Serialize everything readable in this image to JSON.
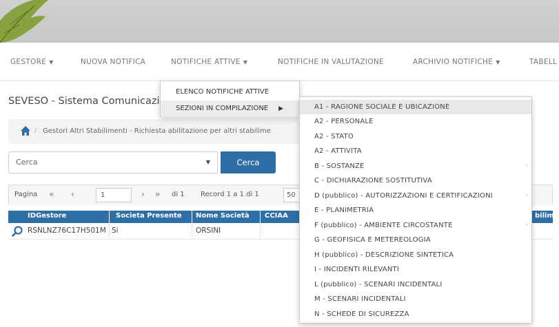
{
  "nav": {
    "items": [
      {
        "label": "GESTORE",
        "caret": true
      },
      {
        "label": "NUOVA NOTIFICA",
        "caret": false
      },
      {
        "label": "NOTIFICHE ATTIVE",
        "caret": true
      },
      {
        "label": "NOTIFICHE IN VALUTAZIONE",
        "caret": false
      },
      {
        "label": "ARCHIVIO NOTIFICHE",
        "caret": true
      },
      {
        "label": "TABELL",
        "caret": false
      }
    ],
    "caret_glyph": "▼"
  },
  "page_title": "SEVESO - Sistema Comunicazi",
  "breadcrumb": {
    "separator": "/",
    "text": "Gestori Altri Stabilimenti - Richiesta abilitazione per altri stabilime"
  },
  "search": {
    "placeholder": "Cerca",
    "button_label": "Cerca",
    "caret": "▼"
  },
  "pager": {
    "label": "Pagina",
    "first": "«",
    "prev": "‹",
    "page": "1",
    "next": "›",
    "last": "»",
    "of": "di 1",
    "records": "Record 1 a 1 di 1",
    "rows_per_page": "50"
  },
  "table": {
    "columns": [
      "IDGestore",
      "Societa Presente",
      "Nome Società",
      "CCIAA",
      "bilimen"
    ],
    "rows": [
      {
        "id": "RSNLNZ76C17H501M",
        "presente": "Si",
        "nome": "ORSINI",
        "cciaa": ""
      }
    ]
  },
  "menu1": {
    "items": [
      {
        "label": "ELENCO NOTIFICHE ATTIVE",
        "submenu": false
      },
      {
        "label": "SEZIONI IN COMPILAZIONE",
        "submenu": true
      }
    ],
    "submenu_glyph": "▶"
  },
  "menu2": {
    "items": [
      {
        "label": "A1 - RAGIONE SOCIALE E UBICAZIONE",
        "submenu": false
      },
      {
        "label": "A2 - PERSONALE",
        "submenu": false
      },
      {
        "label": "A2 - STATO",
        "submenu": false
      },
      {
        "label": "A2 - ATTIVITA",
        "submenu": false
      },
      {
        "label": "B - SOSTANZE",
        "submenu": true
      },
      {
        "label": "C - DICHIARAZIONE SOSTITUTIVA",
        "submenu": false
      },
      {
        "label": "D (pubblico) - AUTORIZZAZIONI E CERTIFICAZIONI",
        "submenu": true
      },
      {
        "label": "E - PLANIMETRIA",
        "submenu": false
      },
      {
        "label": "F (pubblico) - AMBIENTE CIRCOSTANTE",
        "submenu": true
      },
      {
        "label": "G - GEOFISICA E METEREOLOGIA",
        "submenu": false
      },
      {
        "label": "H (pubblico) - DESCRIZIONE SINTETICA",
        "submenu": false
      },
      {
        "label": "I - INCIDENTI RILEVANTI",
        "submenu": false
      },
      {
        "label": "L (pubblico) - SCENARI INCIDENTALI",
        "submenu": false
      },
      {
        "label": "M - SCENARI INCIDENTALI",
        "submenu": false
      },
      {
        "label": "N - SCHEDE DI SICUREZZA",
        "submenu": false
      }
    ],
    "submenu_glyph": "›"
  },
  "colors": {
    "accent": "#2f6fa8",
    "header_bg": "#cccccc",
    "leaf_green": "#7a9a3a"
  }
}
